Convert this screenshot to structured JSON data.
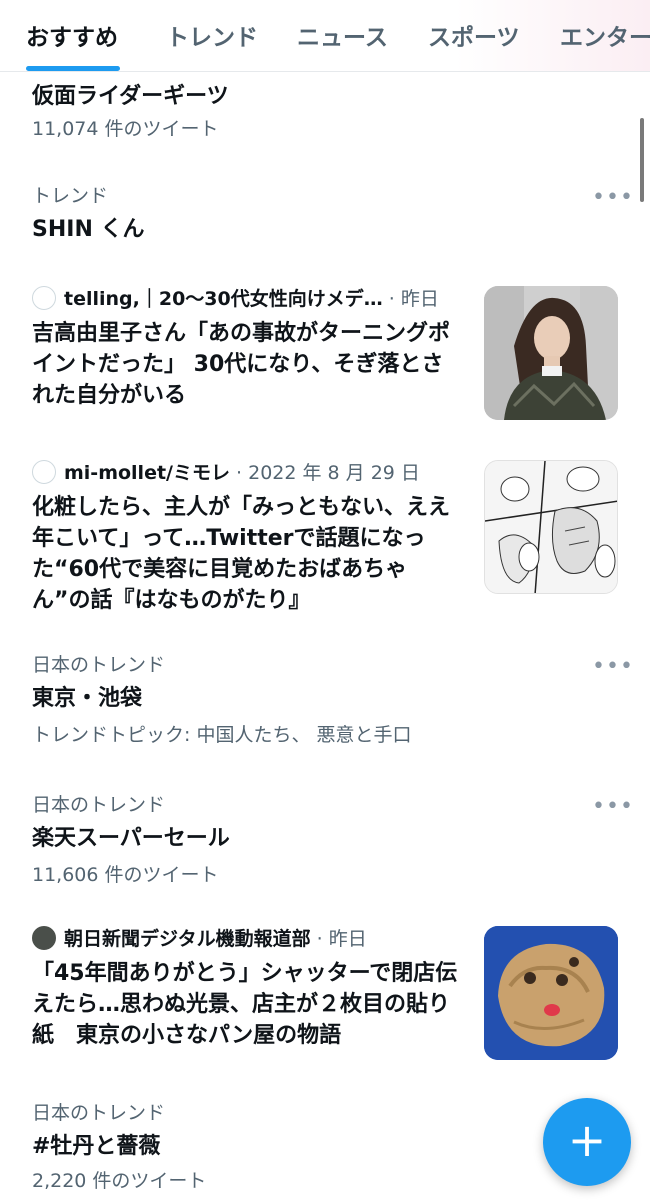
{
  "tabs": [
    "おすすめ",
    "トレンド",
    "ニュース",
    "スポーツ",
    "エンター"
  ],
  "trend1": {
    "title": "仮面ライダーギーツ",
    "count": "11,074 件のツイート"
  },
  "trend2": {
    "meta": "トレンド",
    "title": "SHIN くん"
  },
  "news1": {
    "source": "telling,｜20〜30代女性向けメデ…",
    "time": "· 昨日",
    "title": "吉高由里子さん「あの事故がターニングポイントだった」 30代になり、そぎ落とされた自分がいる"
  },
  "news2": {
    "source": "mi-mollet/ミモレ",
    "time": "· 2022 年 8 月 29 日",
    "title": "化粧したら、主人が「みっともない、ええ年こいて」って…Twitterで話題になった“60代で美容に目覚めたおばあちゃん”の話『はなものがたり』"
  },
  "trend3": {
    "meta": "日本のトレンド",
    "title": "東京・池袋",
    "topic": "トレンドトピック: 中国人たち、 悪意と手口"
  },
  "trend4": {
    "meta": "日本のトレンド",
    "title": "楽天スーパーセール",
    "count": "11,606 件のツイート"
  },
  "news3": {
    "source": "朝日新聞デジタル機動報道部",
    "time": "· 昨日",
    "title": "「45年間ありがとう」シャッターで閉店伝えたら…思わぬ光景、店主が２枚目の貼り紙　東京の小さなパン屋の物語"
  },
  "trend5": {
    "meta": "日本のトレンド",
    "title": "#牡丹と薔薇",
    "count": "2,220 件のツイート"
  },
  "more_label": "•••",
  "fab_label": "+",
  "colors": {
    "accent": "#1d9bf0",
    "text": "#0f1419",
    "secondary": "#536471"
  }
}
